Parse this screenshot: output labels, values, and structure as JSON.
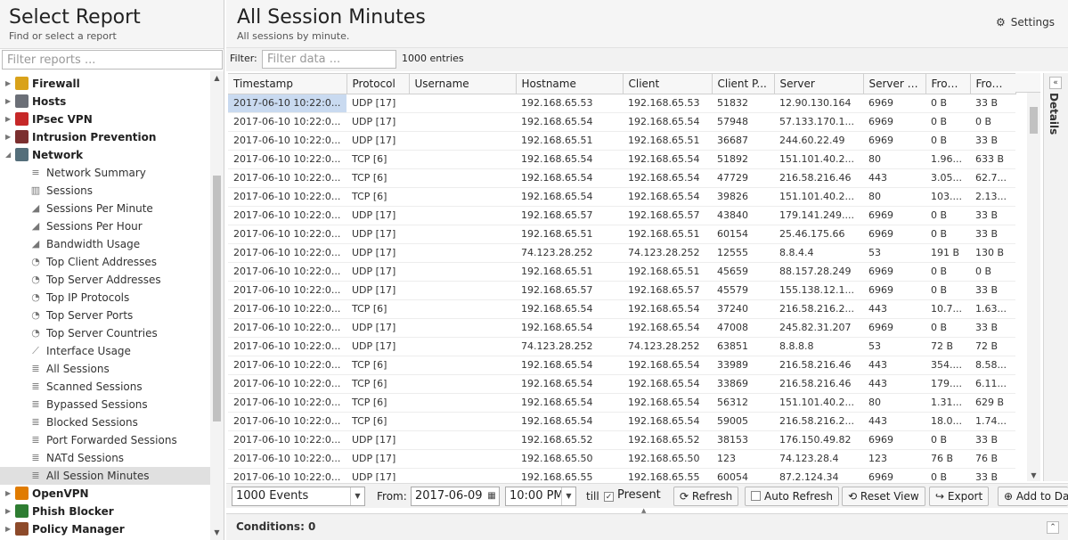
{
  "left": {
    "title": "Select Report",
    "subtitle": "Find or select a report",
    "filter_placeholder": "Filter reports ...",
    "categories_top": [
      {
        "label": "Firewall",
        "color": "#d9a21a"
      },
      {
        "label": "Hosts",
        "color": "#6b6f77"
      },
      {
        "label": "IPsec VPN",
        "color": "#c62828"
      },
      {
        "label": "Intrusion Prevention",
        "color": "#7b2f2f"
      },
      {
        "label": "Network",
        "color": "#546e7a"
      }
    ],
    "network_items": [
      {
        "label": "Network Summary",
        "icon": "list-icon",
        "glyph": "≡"
      },
      {
        "label": "Sessions",
        "icon": "bar-chart-icon",
        "glyph": "▥"
      },
      {
        "label": "Sessions Per Minute",
        "icon": "area-chart-icon",
        "glyph": "◢"
      },
      {
        "label": "Sessions Per Hour",
        "icon": "area-chart-icon",
        "glyph": "◢"
      },
      {
        "label": "Bandwidth Usage",
        "icon": "area-chart-icon",
        "glyph": "◢"
      },
      {
        "label": "Top Client Addresses",
        "icon": "pie-chart-icon",
        "glyph": "◔"
      },
      {
        "label": "Top Server Addresses",
        "icon": "pie-chart-icon",
        "glyph": "◔"
      },
      {
        "label": "Top IP Protocols",
        "icon": "pie-chart-icon",
        "glyph": "◔"
      },
      {
        "label": "Top Server Ports",
        "icon": "pie-chart-icon",
        "glyph": "◔"
      },
      {
        "label": "Top Server Countries",
        "icon": "pie-chart-icon",
        "glyph": "◔"
      },
      {
        "label": "Interface Usage",
        "icon": "line-chart-icon",
        "glyph": "⟋"
      },
      {
        "label": "All Sessions",
        "icon": "list-icon",
        "glyph": "≣"
      },
      {
        "label": "Scanned Sessions",
        "icon": "list-icon",
        "glyph": "≣"
      },
      {
        "label": "Bypassed Sessions",
        "icon": "list-icon",
        "glyph": "≣"
      },
      {
        "label": "Blocked Sessions",
        "icon": "list-icon",
        "glyph": "≣"
      },
      {
        "label": "Port Forwarded Sessions",
        "icon": "list-icon",
        "glyph": "≣"
      },
      {
        "label": "NATd Sessions",
        "icon": "list-icon",
        "glyph": "≣"
      },
      {
        "label": "All Session Minutes",
        "icon": "list-icon",
        "glyph": "≣"
      }
    ],
    "categories_bottom": [
      {
        "label": "OpenVPN",
        "color": "#e07b00"
      },
      {
        "label": "Phish Blocker",
        "color": "#2e7d32"
      },
      {
        "label": "Policy Manager",
        "color": "#8d4a2a"
      }
    ]
  },
  "main": {
    "title": "All Session Minutes",
    "subtitle": "All sessions by minute.",
    "settings_label": "Settings",
    "filter_label": "Filter:",
    "filter_placeholder": "Filter data ...",
    "entries": "1000 entries",
    "details_label": "Details",
    "conditions": "Conditions: 0"
  },
  "grid": {
    "columns": [
      "Timestamp",
      "Protocol",
      "Username",
      "Hostname",
      "Client",
      "Client P...",
      "Server",
      "Server P...",
      "From...",
      "From..."
    ],
    "rows": [
      [
        "2017-06-10 10:22:0...",
        "UDP [17]",
        "",
        "192.168.65.53",
        "192.168.65.53",
        "51832",
        "12.90.130.164",
        "6969",
        "0 B",
        "33 B"
      ],
      [
        "2017-06-10 10:22:0...",
        "UDP [17]",
        "",
        "192.168.65.54",
        "192.168.65.54",
        "57948",
        "57.133.170.1...",
        "6969",
        "0 B",
        "0 B"
      ],
      [
        "2017-06-10 10:22:0...",
        "UDP [17]",
        "",
        "192.168.65.51",
        "192.168.65.51",
        "36687",
        "244.60.22.49",
        "6969",
        "0 B",
        "33 B"
      ],
      [
        "2017-06-10 10:22:0...",
        "TCP [6]",
        "",
        "192.168.65.54",
        "192.168.65.54",
        "51892",
        "151.101.40.2...",
        "80",
        "1.96...",
        "633 B"
      ],
      [
        "2017-06-10 10:22:0...",
        "TCP [6]",
        "",
        "192.168.65.54",
        "192.168.65.54",
        "47729",
        "216.58.216.46",
        "443",
        "3.05...",
        "62.7..."
      ],
      [
        "2017-06-10 10:22:0...",
        "TCP [6]",
        "",
        "192.168.65.54",
        "192.168.65.54",
        "39826",
        "151.101.40.2...",
        "80",
        "103....",
        "2.13..."
      ],
      [
        "2017-06-10 10:22:0...",
        "UDP [17]",
        "",
        "192.168.65.57",
        "192.168.65.57",
        "43840",
        "179.141.249....",
        "6969",
        "0 B",
        "33 B"
      ],
      [
        "2017-06-10 10:22:0...",
        "UDP [17]",
        "",
        "192.168.65.51",
        "192.168.65.51",
        "60154",
        "25.46.175.66",
        "6969",
        "0 B",
        "33 B"
      ],
      [
        "2017-06-10 10:22:0...",
        "UDP [17]",
        "",
        "74.123.28.252",
        "74.123.28.252",
        "12555",
        "8.8.4.4",
        "53",
        "191 B",
        "130 B"
      ],
      [
        "2017-06-10 10:22:0...",
        "UDP [17]",
        "",
        "192.168.65.51",
        "192.168.65.51",
        "45659",
        "88.157.28.249",
        "6969",
        "0 B",
        "0 B"
      ],
      [
        "2017-06-10 10:22:0...",
        "UDP [17]",
        "",
        "192.168.65.57",
        "192.168.65.57",
        "45579",
        "155.138.12.1...",
        "6969",
        "0 B",
        "33 B"
      ],
      [
        "2017-06-10 10:22:0...",
        "TCP [6]",
        "",
        "192.168.65.54",
        "192.168.65.54",
        "37240",
        "216.58.216.2...",
        "443",
        "10.7...",
        "1.63..."
      ],
      [
        "2017-06-10 10:22:0...",
        "UDP [17]",
        "",
        "192.168.65.54",
        "192.168.65.54",
        "47008",
        "245.82.31.207",
        "6969",
        "0 B",
        "33 B"
      ],
      [
        "2017-06-10 10:22:0...",
        "UDP [17]",
        "",
        "74.123.28.252",
        "74.123.28.252",
        "63851",
        "8.8.8.8",
        "53",
        "72 B",
        "72 B"
      ],
      [
        "2017-06-10 10:22:0...",
        "TCP [6]",
        "",
        "192.168.65.54",
        "192.168.65.54",
        "33989",
        "216.58.216.46",
        "443",
        "354....",
        "8.58..."
      ],
      [
        "2017-06-10 10:22:0...",
        "TCP [6]",
        "",
        "192.168.65.54",
        "192.168.65.54",
        "33869",
        "216.58.216.46",
        "443",
        "179....",
        "6.11..."
      ],
      [
        "2017-06-10 10:22:0...",
        "TCP [6]",
        "",
        "192.168.65.54",
        "192.168.65.54",
        "56312",
        "151.101.40.2...",
        "80",
        "1.31...",
        "629 B"
      ],
      [
        "2017-06-10 10:22:0...",
        "TCP [6]",
        "",
        "192.168.65.54",
        "192.168.65.54",
        "59005",
        "216.58.216.2...",
        "443",
        "18.0...",
        "1.74..."
      ],
      [
        "2017-06-10 10:22:0...",
        "UDP [17]",
        "",
        "192.168.65.52",
        "192.168.65.52",
        "38153",
        "176.150.49.82",
        "6969",
        "0 B",
        "33 B"
      ],
      [
        "2017-06-10 10:22:0...",
        "UDP [17]",
        "",
        "192.168.65.50",
        "192.168.65.50",
        "123",
        "74.123.28.4",
        "123",
        "76 B",
        "76 B"
      ],
      [
        "2017-06-10 10:22:0...",
        "UDP [17]",
        "",
        "192.168.65.55",
        "192.168.65.55",
        "60054",
        "87.2.124.34",
        "6969",
        "0 B",
        "33 B"
      ]
    ]
  },
  "toolbar": {
    "events": "1000 Events",
    "from_label": "From:",
    "from_date": "2017-06-09",
    "from_time": "10:00 PM",
    "till_label": "till",
    "present_label": "Present",
    "present_checked": true,
    "refresh": "Refresh",
    "auto_refresh": "Auto Refresh",
    "reset_view": "Reset View",
    "export": "Export",
    "add_to_dashboard": "Add to Da"
  }
}
